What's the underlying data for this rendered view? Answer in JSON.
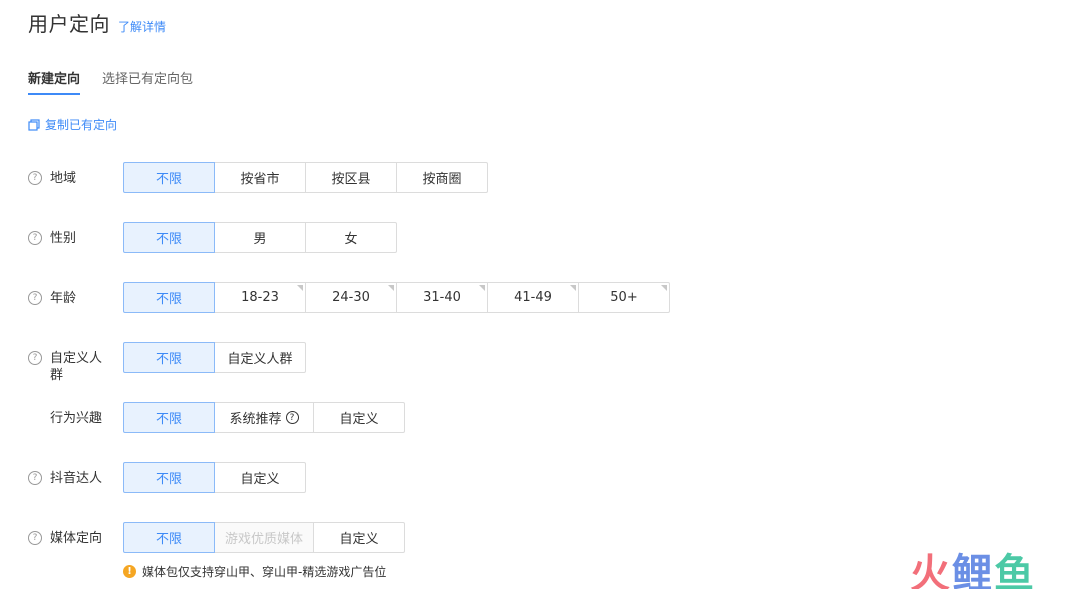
{
  "header": {
    "title": "用户定向",
    "learn_more": "了解详情"
  },
  "tabs": [
    {
      "label": "新建定向",
      "active": true
    },
    {
      "label": "选择已有定向包",
      "active": false
    }
  ],
  "copy_link": "复制已有定向",
  "rows": {
    "region": {
      "label": "地域",
      "options": [
        "不限",
        "按省市",
        "按区县",
        "按商圈"
      ],
      "selected": "不限"
    },
    "gender": {
      "label": "性别",
      "options": [
        "不限",
        "男",
        "女"
      ],
      "selected": "不限"
    },
    "age": {
      "label": "年龄",
      "options": [
        "不限",
        "18-23",
        "24-30",
        "31-40",
        "41-49",
        "50+"
      ],
      "selected": "不限"
    },
    "custom_audience": {
      "label": "自定义人群",
      "options": [
        "不限",
        "自定义人群"
      ],
      "selected": "不限"
    },
    "behavior_interest": {
      "label": "行为兴趣",
      "options": [
        "不限",
        "系统推荐",
        "自定义"
      ],
      "selected": "不限"
    },
    "douyin_influencer": {
      "label": "抖音达人",
      "options": [
        "不限",
        "自定义"
      ],
      "selected": "不限"
    },
    "media": {
      "label": "媒体定向",
      "options": [
        "不限",
        "游戏优质媒体",
        "自定义"
      ],
      "selected": "不限",
      "disabled": [
        "游戏优质媒体"
      ]
    }
  },
  "notice": "媒体包仅支持穿山甲、穿山甲-精选游戏广告位",
  "watermark": {
    "chars": [
      "火",
      "鲤",
      "鱼"
    ]
  },
  "colors": {
    "accent": "#3d8af7",
    "selected_bg": "#e8f2fe",
    "warning": "#f5a623"
  }
}
